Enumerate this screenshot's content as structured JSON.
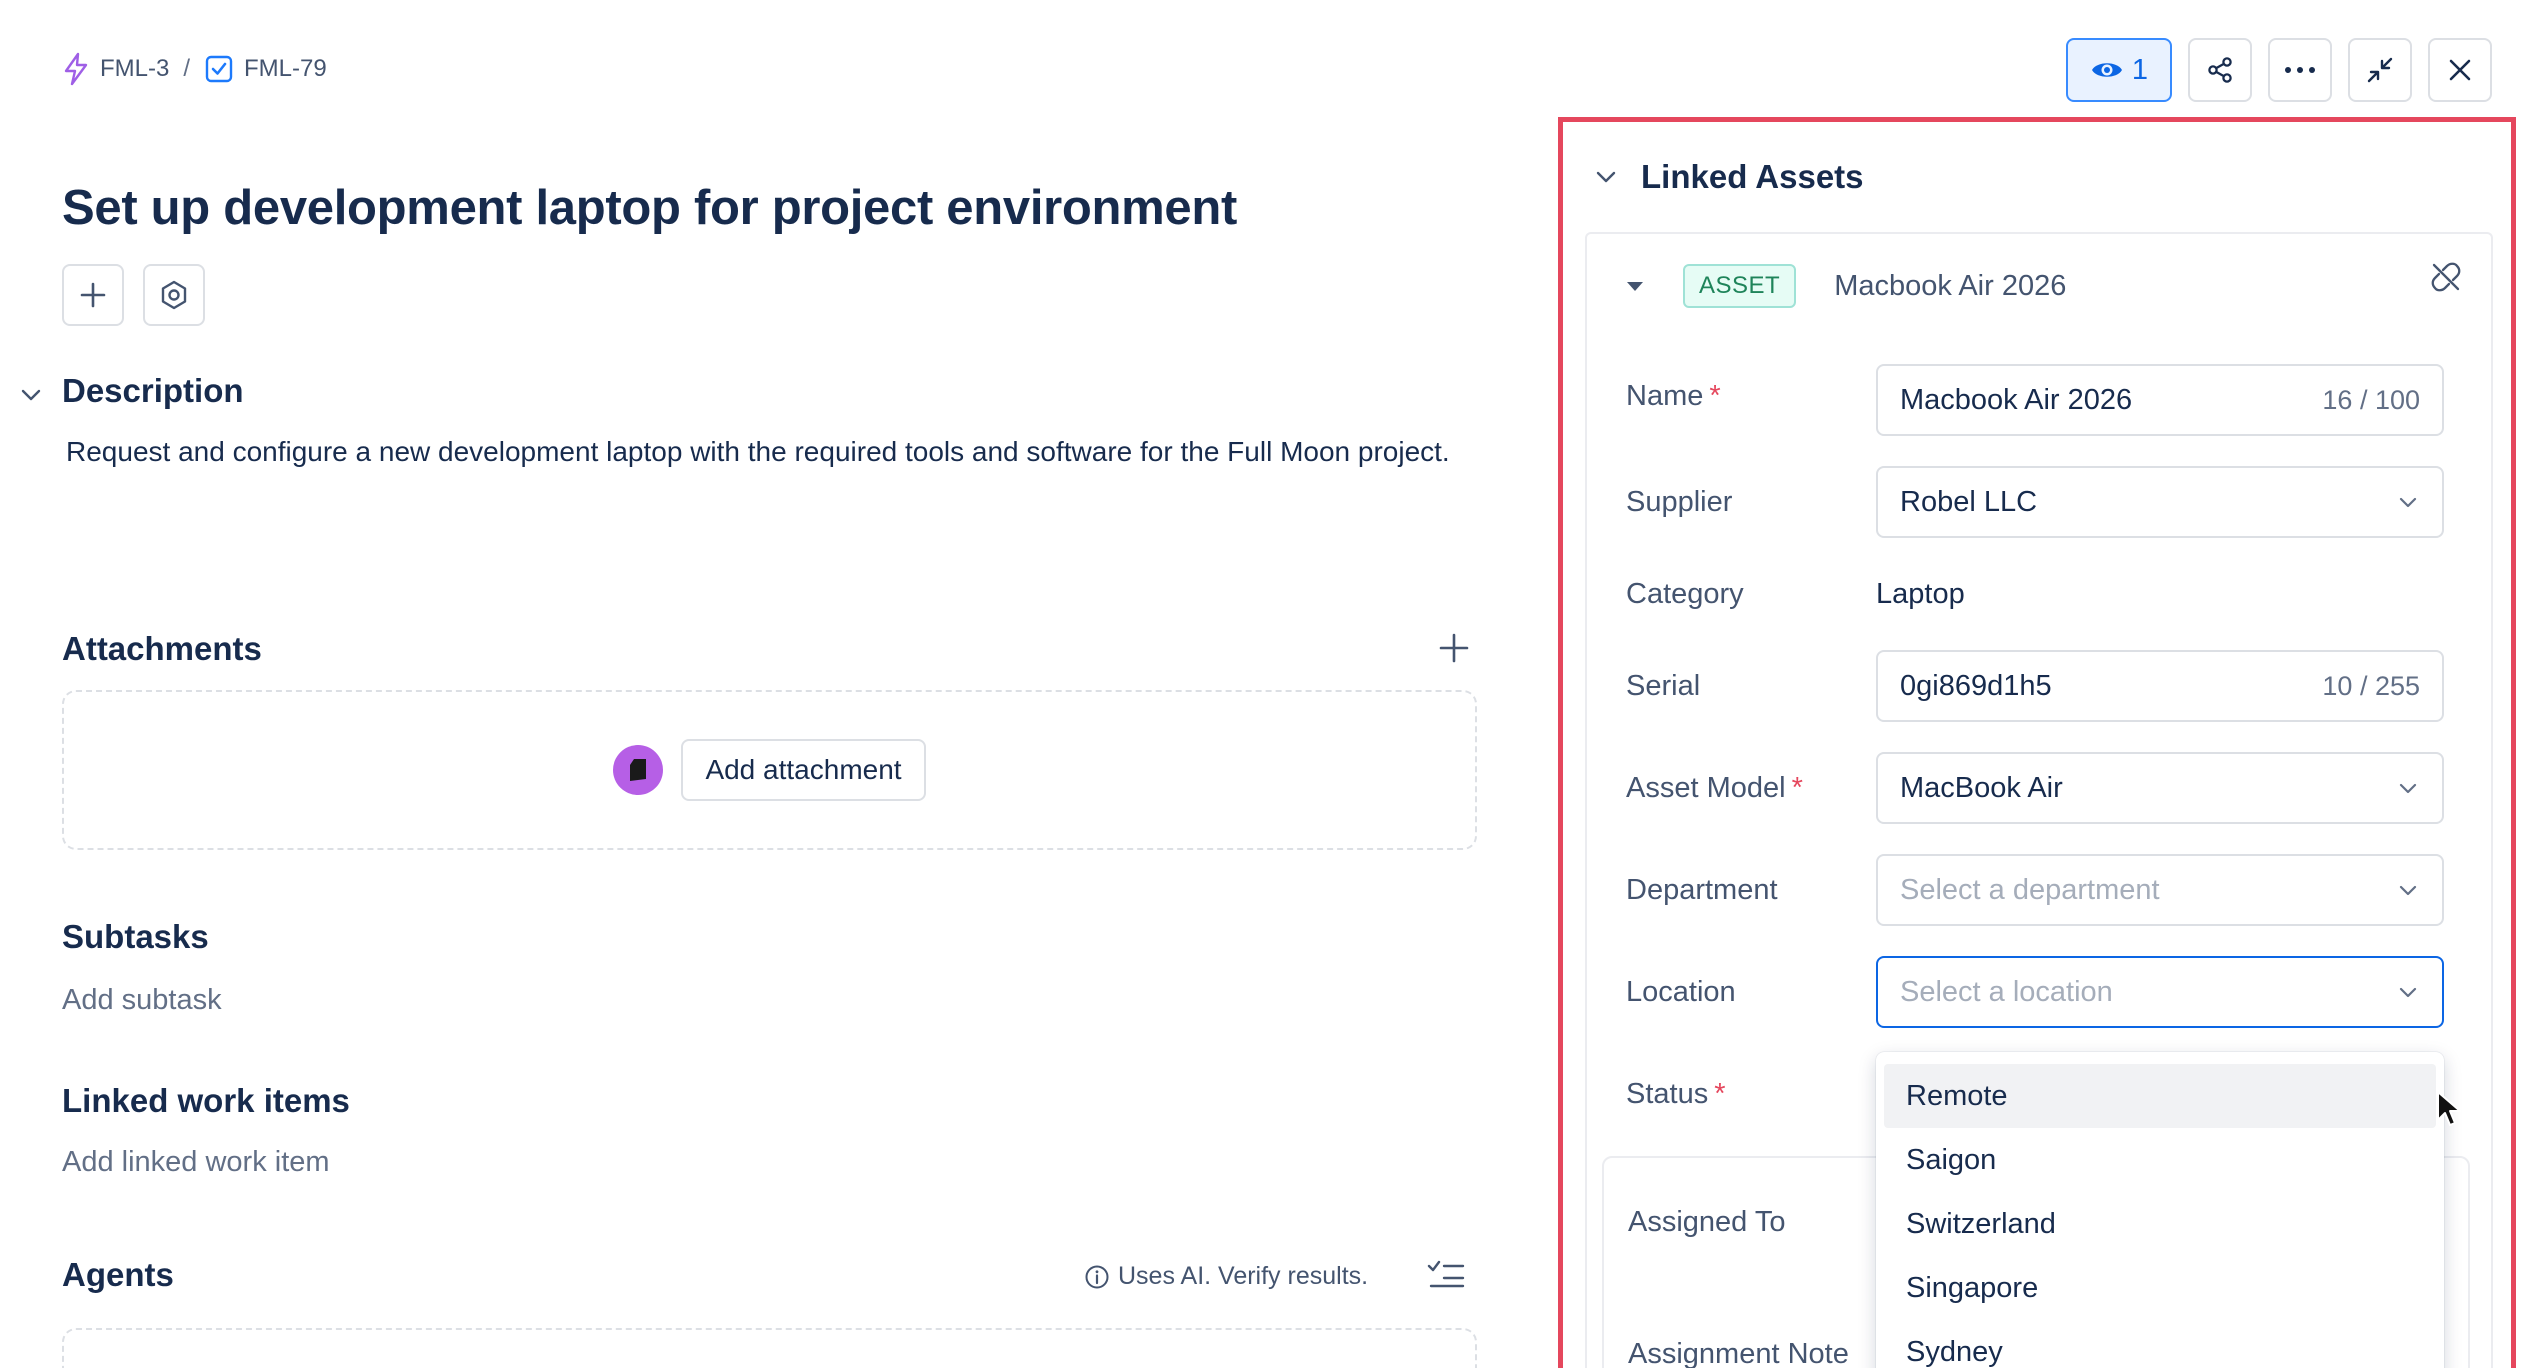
{
  "breadcrumb": {
    "parent": "FML-3",
    "separator": "/",
    "current": "FML-79"
  },
  "issue": {
    "title": "Set up development laptop for project environment"
  },
  "description": {
    "heading": "Description",
    "text": "Request and configure a new development laptop with the required tools and software for the Full Moon project."
  },
  "attachments": {
    "heading": "Attachments",
    "button_label": "Add attachment"
  },
  "subtasks": {
    "heading": "Subtasks",
    "add_label": "Add subtask"
  },
  "linked_work_items": {
    "heading": "Linked work items",
    "add_label": "Add linked work item"
  },
  "agents": {
    "heading": "Agents",
    "ai_note": "Uses AI. Verify results."
  },
  "toolbar": {
    "watch_count": "1"
  },
  "linked_assets": {
    "heading": "Linked Assets",
    "asset": {
      "badge": "ASSET",
      "name": "Macbook Air 2026"
    },
    "fields": {
      "name": {
        "label": "Name",
        "value": "Macbook Air 2026",
        "count": "16 / 100"
      },
      "supplier": {
        "label": "Supplier",
        "value": "Robel LLC"
      },
      "category": {
        "label": "Category",
        "value": "Laptop"
      },
      "serial": {
        "label": "Serial",
        "value": "0gi869d1h5",
        "count": "10 / 255"
      },
      "asset_model": {
        "label": "Asset Model",
        "value": "MacBook Air"
      },
      "department": {
        "label": "Department",
        "placeholder": "Select a department"
      },
      "location": {
        "label": "Location",
        "placeholder": "Select a location"
      },
      "status": {
        "label": "Status"
      },
      "assigned_to": {
        "label": "Assigned To"
      },
      "assignment_note": {
        "label": "Assignment Note"
      }
    },
    "required_mark": "*",
    "location_options": [
      "Remote",
      "Saigon",
      "Switzerland",
      "Singapore",
      "Sydney"
    ]
  },
  "colors": {
    "highlight_border": "#e5475d",
    "accent": "#0c66e4",
    "asset_badge": "#1f845a"
  }
}
